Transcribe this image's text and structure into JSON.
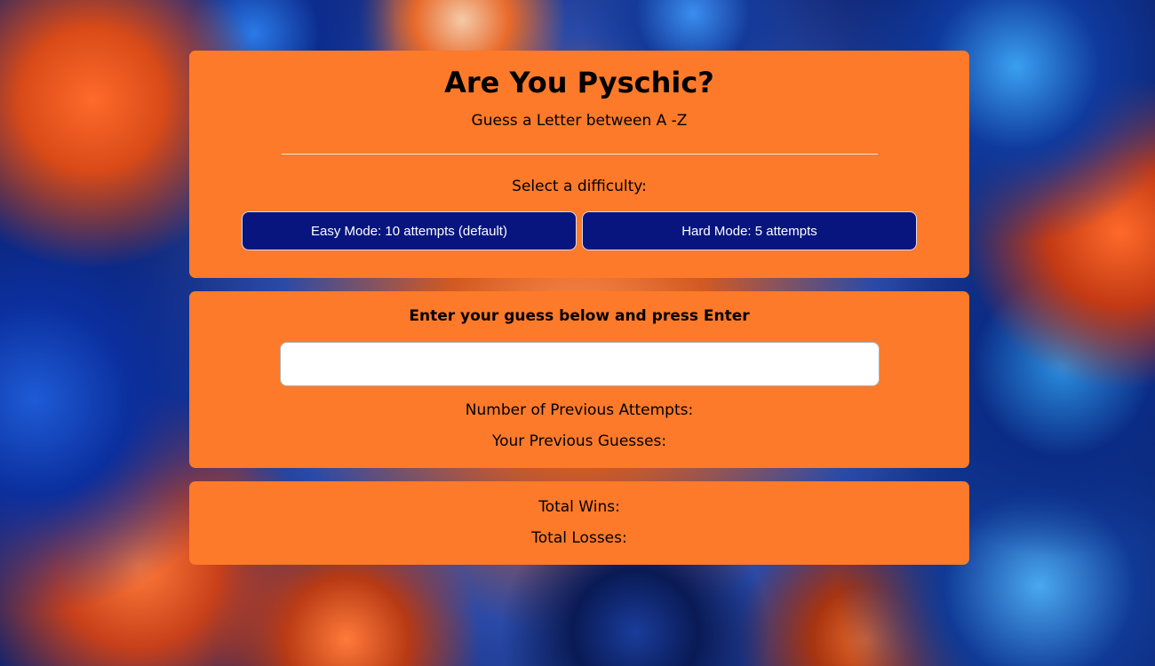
{
  "header": {
    "title": "Are You Pyschic?",
    "subtitle": "Guess a Letter between A -Z"
  },
  "difficulty": {
    "label": "Select a difficulty:",
    "easy_label": "Easy Mode: 10 attempts (default)",
    "hard_label": "Hard Mode: 5 attempts"
  },
  "guess": {
    "label": "Enter your guess below and press Enter",
    "value": "",
    "placeholder": "",
    "attempts_label": "Number of Previous Attempts:",
    "previous_guesses_label": "Your Previous Guesses:"
  },
  "totals": {
    "wins_label": "Total Wins:",
    "losses_label": "Total Losses:"
  },
  "colors": {
    "panel": "#fd7a2a",
    "button": "#08157f",
    "button_text": "#ffffff"
  }
}
